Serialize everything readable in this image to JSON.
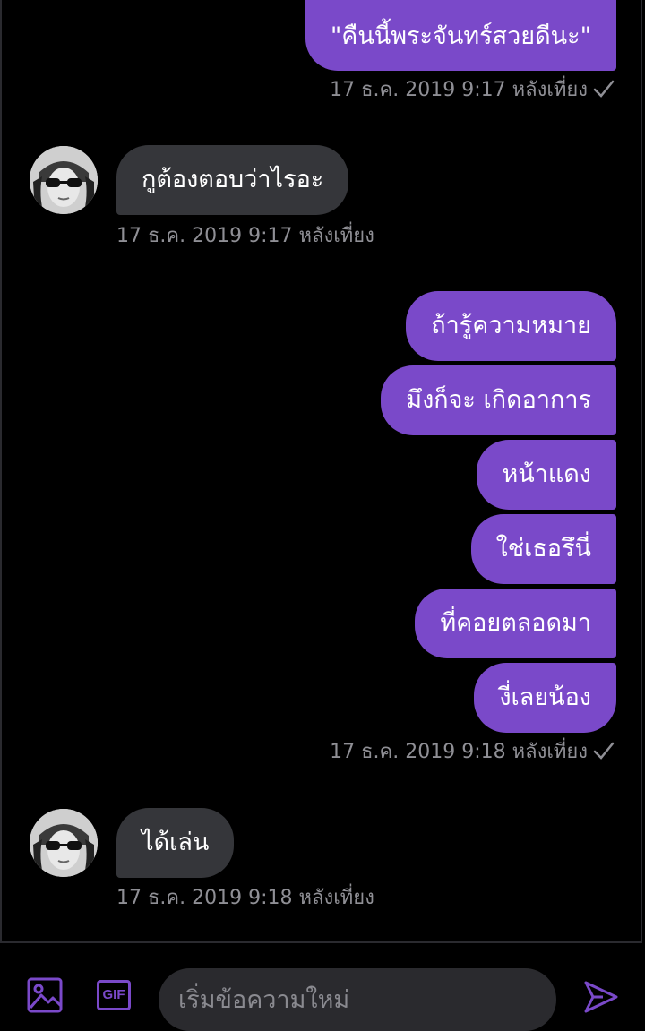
{
  "colors": {
    "outgoing_bubble": "#7a49c9",
    "incoming_bubble": "#35363a",
    "background": "#000000",
    "accent": "#7a49c9"
  },
  "messages": {
    "m1": {
      "text": "\"คืนนี้พระจันทร์สวยดีนะ\"",
      "timestamp": "17 ธ.ค. 2019 9:17 หลังเที่ยง"
    },
    "m2": {
      "text": "กูต้องตอบว่าไรอะ",
      "timestamp": "17 ธ.ค. 2019 9:17 หลังเที่ยง"
    },
    "group3": {
      "lines": [
        "ถ้ารู้ความหมาย",
        "มึงก็จะ เกิดอาการ",
        "หน้าแดง",
        "ใช่เธอรึนี่",
        "ที่คอยตลอดมา",
        "งี่เลยน้อง"
      ],
      "timestamp": "17 ธ.ค. 2019 9:18 หลังเที่ยง"
    },
    "m4": {
      "text": "ได้เล่น",
      "timestamp": "17 ธ.ค. 2019 9:18 หลังเที่ยง"
    }
  },
  "composer": {
    "placeholder": "เริ่มข้อความใหม่",
    "gif_label": "GIF",
    "image_icon": "image-icon",
    "send_icon": "send-icon"
  }
}
